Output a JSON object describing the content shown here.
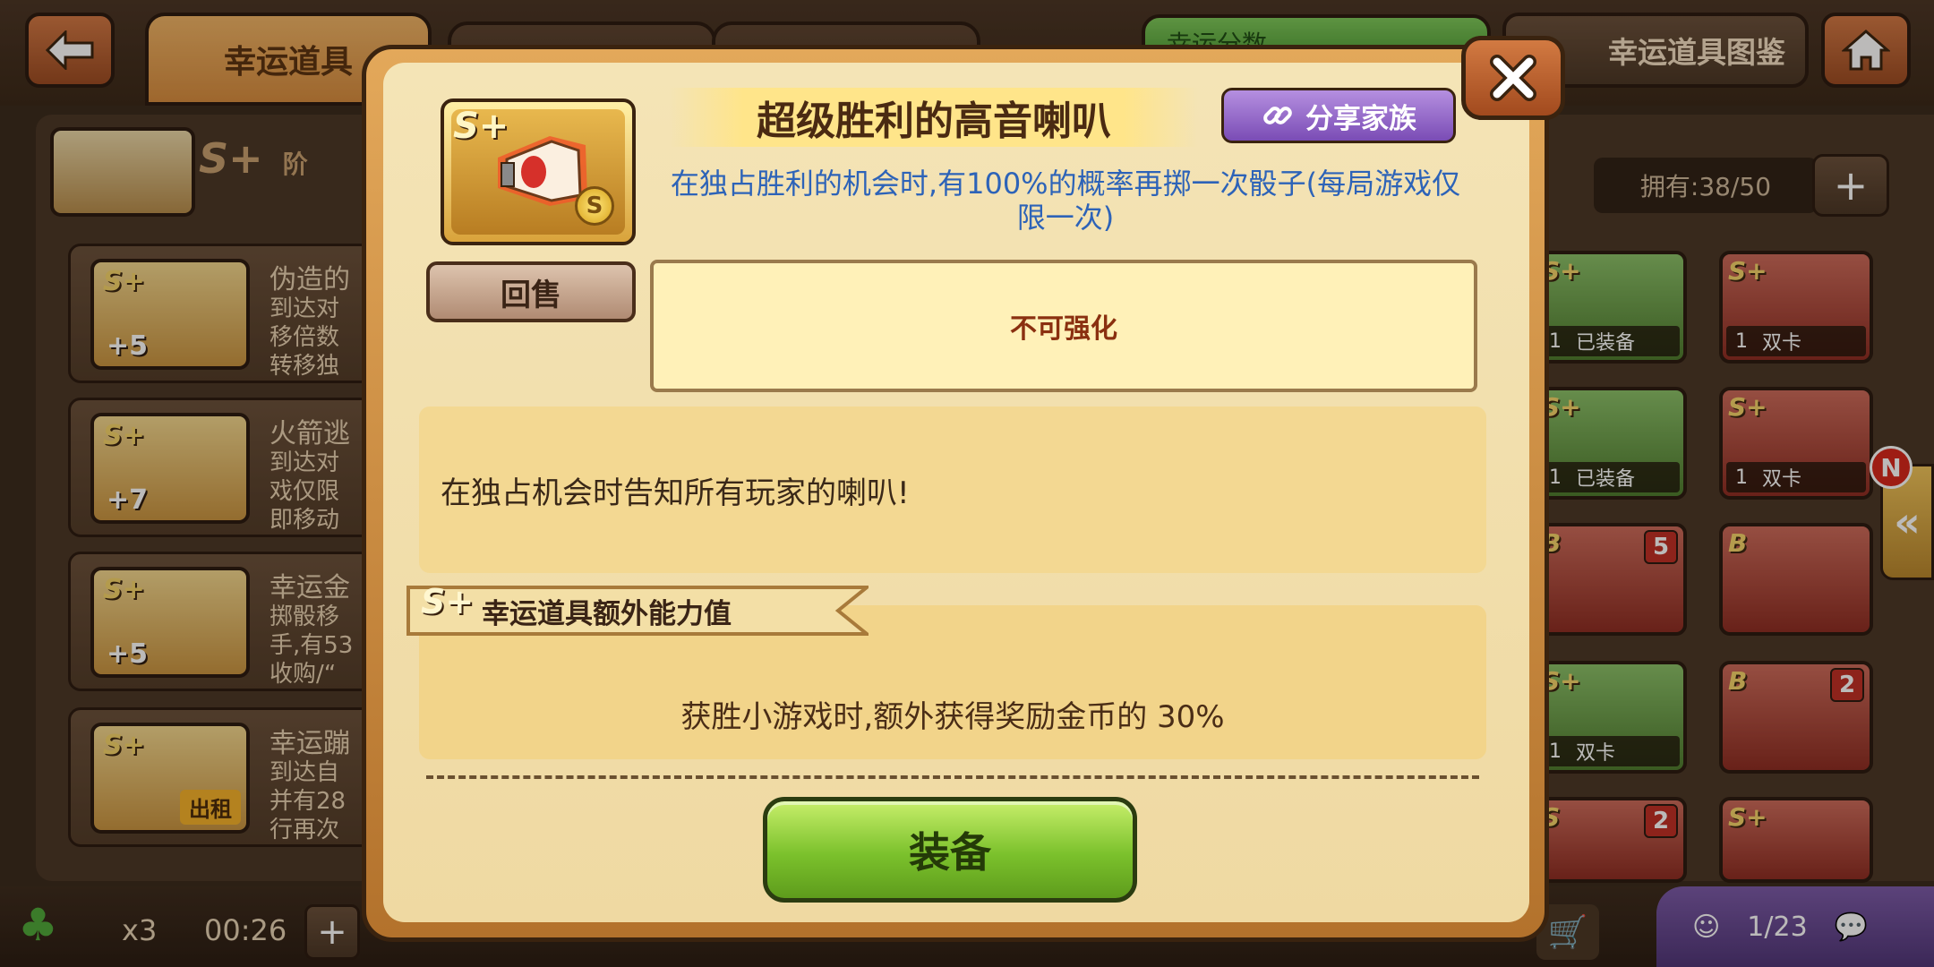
{
  "header": {
    "back_icon": "back-arrow-icon",
    "tab_lucky": "幸运道具",
    "score_label": "幸运分数",
    "catalog_label": "幸运道具图鉴",
    "home_icon": "home-icon"
  },
  "character": {
    "grade": "S+",
    "level_label": "阶"
  },
  "inventory": {
    "owned": "拥有:38/50",
    "plus": "+"
  },
  "list": [
    {
      "title": "伪造的",
      "desc": [
        "到达对",
        "移倍数",
        "转移独"
      ],
      "grade": "S+",
      "plus": "+5"
    },
    {
      "title": "火箭逃",
      "desc": [
        "到达对",
        "戏仅限",
        "即移动"
      ],
      "grade": "S+",
      "plus": "+7"
    },
    {
      "title": "幸运金",
      "desc": [
        "掷骰移",
        "手,有53",
        "收购/“"
      ],
      "grade": "S+",
      "plus": "+5"
    },
    {
      "title": "幸运蹦",
      "desc": [
        "到达自",
        "并有28",
        "行再次"
      ],
      "grade": "S+",
      "tag": "出租"
    }
  ],
  "grid": [
    {
      "grade": "S+",
      "count": "1",
      "status": "已装备",
      "color": "green"
    },
    {
      "grade": "S+",
      "count": "1",
      "status": "双卡",
      "color": "red"
    },
    {
      "grade": "S+",
      "count": "1",
      "status": "已装备",
      "color": "green"
    },
    {
      "grade": "S+",
      "count": "1",
      "status": "双卡",
      "color": "red"
    },
    {
      "grade": "B",
      "num": "5",
      "color": "red"
    },
    {
      "grade": "B",
      "color": "red"
    },
    {
      "grade": "S+",
      "count": "1",
      "status": "双卡",
      "color": "green"
    },
    {
      "grade": "B",
      "num": "2",
      "color": "red"
    },
    {
      "grade": "S",
      "num": "2",
      "color": "red"
    },
    {
      "grade": "S+",
      "color": "red"
    }
  ],
  "side": {
    "badge": "N",
    "arrow": "«"
  },
  "bottom": {
    "clover_count": "x3",
    "timer": "00:26",
    "plus": "+",
    "chat_count": "1/23"
  },
  "modal": {
    "item_grade": "S+",
    "item_coin": "S",
    "title": "超级胜利的高音喇叭",
    "share_label": "分享家族",
    "effect": "在独占胜利的机会时,有100%的概率再掷一次骰子(每局游戏仅限一次)",
    "sell_label": "回售",
    "enhance": "不可强化",
    "description": "在独占机会时告知所有玩家的喇叭!",
    "extra_tag_grade": "S+",
    "extra_tag_label": "幸运道具额外能力值",
    "extra_text": "获胜小游戏时,额外获得奖励金币的 30%",
    "equip_label": "装备"
  },
  "colors": {
    "equip_green": "#7bc12c",
    "share_purple": "#7a4cb5",
    "effect_blue": "#2d63b8",
    "modal_gold": "#e3a85a"
  }
}
